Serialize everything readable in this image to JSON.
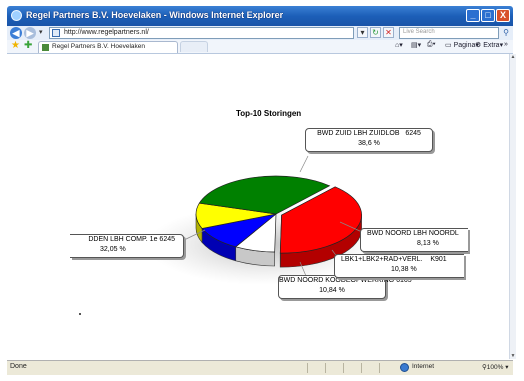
{
  "window": {
    "title": "Regel Partners B.V. Hoevelaken - Windows Internet Explorer",
    "minimize": "_",
    "maximize": "□",
    "close": "X"
  },
  "nav": {
    "back": "◀",
    "forward": "▶",
    "url": "http://www.regelpartners.nl/",
    "search_placeholder": "Live Search"
  },
  "tabs": [
    {
      "title": "Regel Partners B.V. Hoevelaken"
    }
  ],
  "commands": {
    "page": "Pagina",
    "tools": "Extra"
  },
  "chart_data": {
    "type": "pie",
    "title": "Top-10 Storingen",
    "slices": [
      {
        "label": "BWD ZUID LBH ZUIDLOB",
        "count": "6245",
        "percent_text": "38,6 %",
        "value": 38.6,
        "color": "#ff0000"
      },
      {
        "label": "BWD NOORD LBH NOORDL",
        "count": "",
        "percent_text": "8,13 %",
        "value": 8.13,
        "color": "#ffffff"
      },
      {
        "label": "LBK1+LBK2+RAD+VERL.",
        "count": "K901",
        "percent_text": "10,38 %",
        "value": 10.38,
        "color": "#0000ff"
      },
      {
        "label": "BWD NOORD KOODEOPWERKING",
        "count": "6165",
        "percent_text": "10,84 %",
        "value": 10.84,
        "color": "#ffff00"
      },
      {
        "label": "DDEN LBH COMP. 1e",
        "count": "6245",
        "percent_text": "32,05 %",
        "value": 32.05,
        "color": "#008000"
      }
    ]
  },
  "status": {
    "text": "Done",
    "zone": "Internet",
    "zoom": "100%"
  }
}
